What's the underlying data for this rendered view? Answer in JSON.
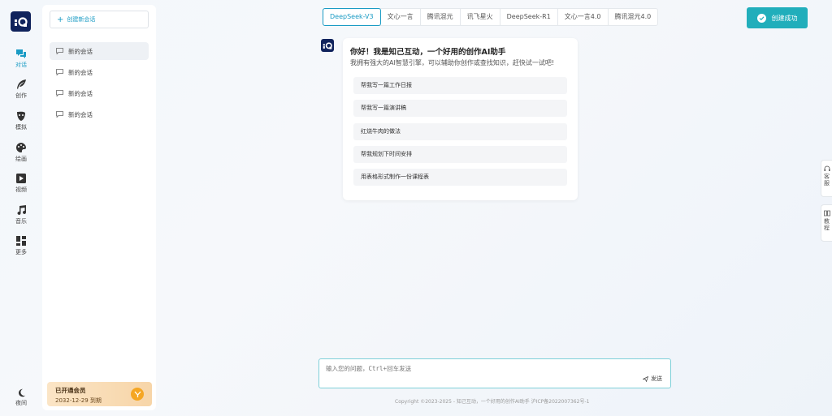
{
  "brand": {
    "logo_icon": "brand-logo-icon"
  },
  "rail": [
    {
      "label": "对话",
      "icon": "chat-icon",
      "active": true
    },
    {
      "label": "创作",
      "icon": "feather-icon"
    },
    {
      "label": "模拟",
      "icon": "mask-icon"
    },
    {
      "label": "绘画",
      "icon": "palette-icon"
    },
    {
      "label": "视频",
      "icon": "video-icon"
    },
    {
      "label": "音乐",
      "icon": "music-icon"
    },
    {
      "label": "更多",
      "icon": "grid-icon"
    }
  ],
  "rail_bottom": {
    "label": "夜间",
    "icon": "moon-icon"
  },
  "sidebar": {
    "new_chat": "创建新会话",
    "conversations": [
      "新的会话",
      "新的会话",
      "新的会话",
      "新的会话"
    ],
    "member": {
      "title": "已开通会员",
      "expiry": "2032-12-29 到期"
    }
  },
  "model_tabs": [
    "DeepSeek-V3",
    "文心一言",
    "腾讯混元",
    "讯飞星火",
    "DeepSeek-R1",
    "文心一言4.0",
    "腾讯混元4.0"
  ],
  "active_model": "DeepSeek-V3",
  "toast": {
    "text": "创建成功"
  },
  "welcome": {
    "title": "你好！我是知己互动，一个好用的创作AI助手",
    "subtitle": "我拥有强大的AI智慧引擎，可以辅助你创作或查找知识，赶快试一试吧!",
    "suggestions": [
      "帮我写一篇工作日报",
      "帮我写一篇演讲稿",
      "红烧牛肉的做法",
      "帮我规划下时间安排",
      "用表格形式制作一份课程表"
    ]
  },
  "side_float": [
    {
      "label": "客服",
      "icon": "headset-icon"
    },
    {
      "label": "教程",
      "icon": "book-icon"
    }
  ],
  "input": {
    "placeholder": "输入您的问题，Ctrl+回车发送",
    "value": "",
    "send_label": "发送"
  },
  "footer": "Copyright ©2023-2025 - 知己互动，一个好用的创作AI助手    沪ICP备2022007362号-1",
  "colors": {
    "accent": "#1a9bc4",
    "toast": "#21aebb",
    "brand": "#10235c"
  }
}
